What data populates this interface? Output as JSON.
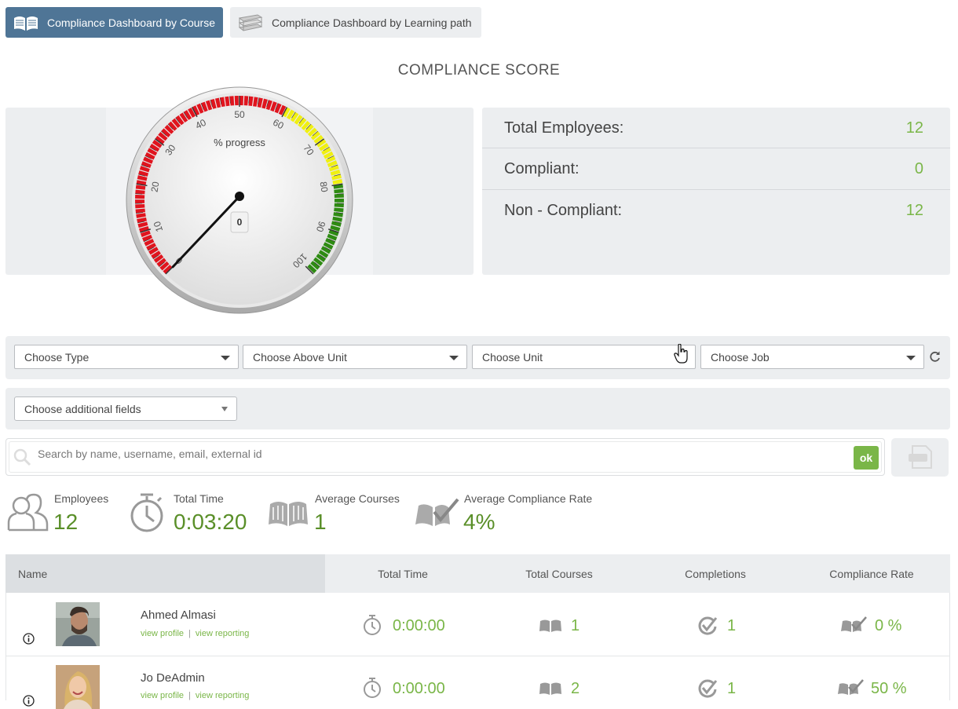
{
  "tabs": [
    {
      "label": "Compliance Dashboard by Course",
      "icon": "open-book-icon",
      "active": true
    },
    {
      "label": "Compliance Dashboard by Learning path",
      "icon": "book-stack-icon",
      "active": false
    }
  ],
  "page_title": "COMPLIANCE SCORE",
  "gauge": {
    "label": "% progress",
    "value": 0,
    "display_value": "0",
    "ticks": [
      "0",
      "10",
      "20",
      "30",
      "40",
      "50",
      "60",
      "70",
      "80",
      "90",
      "100"
    ],
    "zones": {
      "red": "#e0141e",
      "yellow": "#f0f010",
      "green": "#2e8b12"
    }
  },
  "stats": {
    "total_label": "Total Employees:",
    "total_value": "12",
    "compliant_label": "Compliant:",
    "compliant_value": "0",
    "noncompliant_label": "Non - Compliant:",
    "noncompliant_value": "12"
  },
  "filters": {
    "type": "Choose Type",
    "above_unit": "Choose Above Unit",
    "unit": "Choose Unit",
    "job": "Choose Job",
    "additional": "Choose additional fields"
  },
  "search": {
    "placeholder": "Search by name, username, email, external id",
    "ok_label": "ok"
  },
  "kpis": {
    "employees_label": "Employees",
    "employees_value": "12",
    "time_label": "Total Time",
    "time_value": "0:03:20",
    "courses_label": "Average Courses",
    "courses_value": "1",
    "rate_label": "Average Compliance Rate",
    "rate_value": "4%"
  },
  "table": {
    "headers": {
      "name": "Name",
      "time": "Total Time",
      "courses": "Total Courses",
      "completions": "Completions",
      "rate": "Compliance Rate"
    },
    "rows": [
      {
        "name": "Ahmed Almasi",
        "profile": "view profile",
        "reporting": "view reporting",
        "time": "0:00:00",
        "courses": "1",
        "completions": "1",
        "rate": "0 %"
      },
      {
        "name": "Jo DeAdmin",
        "profile": "view profile",
        "reporting": "view reporting",
        "time": "0:00:00",
        "courses": "2",
        "completions": "1",
        "rate": "50 %"
      }
    ]
  },
  "colors": {
    "accent": "#7ab648",
    "tab_active": "#4f7596",
    "panel": "#eceef0"
  }
}
